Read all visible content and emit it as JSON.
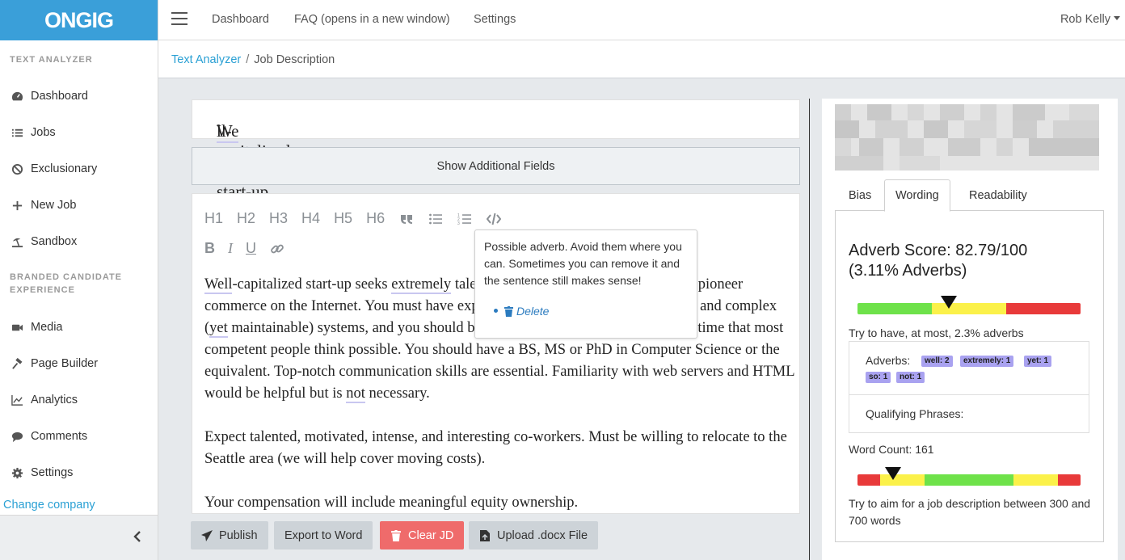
{
  "app": {
    "logo": "ONGIG"
  },
  "topbar": {
    "nav": [
      "Dashboard",
      "FAQ (opens in a new window)",
      "Settings"
    ],
    "user": "Rob Kelly"
  },
  "breadcrumb": {
    "root": "Text Analyzer",
    "current": "Job Description"
  },
  "sidebar": {
    "heading1": "TEXT ANALYZER",
    "items1": [
      {
        "label": "Dashboard",
        "icon": "tachometer-icon"
      },
      {
        "label": "Jobs",
        "icon": "list-icon"
      },
      {
        "label": "Exclusionary",
        "icon": "ban-icon"
      },
      {
        "label": "New Job",
        "icon": "plus-icon"
      },
      {
        "label": "Sandbox",
        "icon": "umbrella-beach-icon"
      }
    ],
    "heading2a": "BRANDED CANDIDATE",
    "heading2b": "EXPERIENCE",
    "items2": [
      {
        "label": "Media",
        "icon": "video-icon"
      },
      {
        "label": "Page Builder",
        "icon": "hammer-icon"
      },
      {
        "label": "Analytics",
        "icon": "line-chart-icon"
      },
      {
        "label": "Comments",
        "icon": "comment-icon"
      },
      {
        "label": "Settings",
        "icon": "gear-icon"
      }
    ],
    "change_company": "Change company"
  },
  "job": {
    "title": "Well-capitalized Seattle start-up seeks Unix developers",
    "show_fields": "Show Additional Fields"
  },
  "toolbar": {
    "headings": [
      "H1",
      "H2",
      "H3",
      "H4",
      "H5",
      "H6"
    ]
  },
  "editor": {
    "p1_a": "Well",
    "p1_b": "-capitalized start-up seeks ",
    "p1_c": "extremely",
    "p1_d": " talented C/C++/Unix developers to help pioneer commerce on the Internet. You must have experience designing and building large and complex (",
    "p1_e": "yet",
    "p1_f": " maintainable) systems, and you should be able to do so in about one-third the time that most competent people think possible. You should have a BS, MS or PhD in Computer Science or the equivalent. Top-notch communication skills are essential. Familiarity with web servers and HTML would be helpful but is ",
    "p1_g": "not",
    "p1_h": " necessary.",
    "p2": "Expect talented, motivated, intense, and interesting co-workers. Must be willing to relocate to the Seattle area (we will help cover moving costs).",
    "p3": "Your compensation will include meaningful equity ownership."
  },
  "tooltip": {
    "message": "Possible adverb. Avoid them where you can. Sometimes you can remove it and the sentence still makes sense!",
    "delete": "Delete"
  },
  "actions": {
    "publish": "Publish",
    "export": "Export to Word",
    "clear": "Clear JD",
    "upload": "Upload .docx File"
  },
  "panel": {
    "tabs": [
      "Bias",
      "Wording",
      "Readability"
    ],
    "active_tab": "Wording",
    "adverb_score_line1": "Adverb Score: 82.79/100",
    "adverb_score_line2": "(3.11% Adverbs)",
    "adverb_hint": "Try to have, at most, 2.3% adverbs",
    "adverbs_label": "Adverbs:",
    "adverb_pills": [
      "well: 2",
      "extremely: 1",
      "yet: 1",
      "so: 1",
      "not: 1"
    ],
    "qualifying_label": "Qualifying Phrases:",
    "word_count": "Word Count: 161",
    "word_hint": "Try to aim for a job description between 300 and 700 words",
    "adverb_gauge_level": 0.41,
    "word_gauge_level": 0.16
  },
  "colors": {
    "brand": "#3a9fd9",
    "link": "#2aa0d4",
    "gauge_green": "#6ee24a",
    "gauge_yellow": "#fbf14a",
    "gauge_red": "#e83a3a",
    "pill": "#a9a2f0",
    "clear_button": "#ef6b6b"
  }
}
